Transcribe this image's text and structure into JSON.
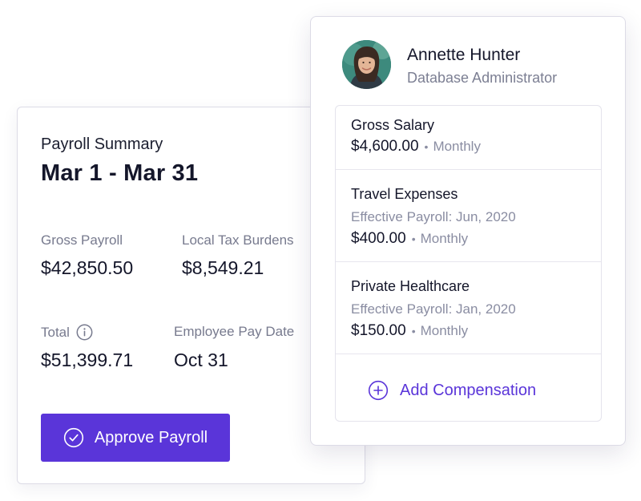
{
  "payroll": {
    "eyebrow": "Payroll Summary",
    "period": "Mar 1 - Mar 31",
    "stats": [
      {
        "label": "Gross Payroll",
        "value": "$42,850.50"
      },
      {
        "label": "Local Tax Burdens",
        "value": "$8,549.21"
      },
      {
        "label": "Total",
        "value": "$51,399.71",
        "icon": "info-icon"
      },
      {
        "label": "Employee Pay Date",
        "value": "Oct 31"
      }
    ],
    "approve_label": "Approve Payroll",
    "approve_icon": "check-circle-icon"
  },
  "employee": {
    "name": "Annette Hunter",
    "role": "Database Administrator",
    "compensations": [
      {
        "title": "Gross Salary",
        "effective": "",
        "amount": "$4,600.00",
        "frequency": "Monthly"
      },
      {
        "title": "Travel Expenses",
        "effective": "Effective Payroll: Jun, 2020",
        "amount": "$400.00",
        "frequency": "Monthly"
      },
      {
        "title": "Private Healthcare",
        "effective": "Effective Payroll: Jan, 2020",
        "amount": "$150.00",
        "frequency": "Monthly"
      }
    ],
    "separator": "•",
    "add_label": "Add Compensation",
    "add_icon": "plus-circle-icon"
  },
  "colors": {
    "accent": "#5a35d9",
    "text_primary": "#14162a",
    "text_muted": "#8a8da2",
    "border": "#dcdbe6"
  }
}
